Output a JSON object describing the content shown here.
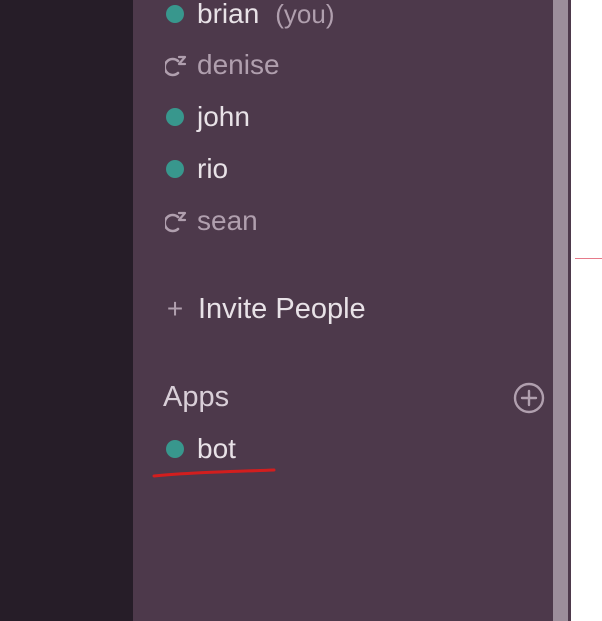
{
  "members": [
    {
      "name": "brian",
      "suffix": "(you)",
      "status": "active"
    },
    {
      "name": "denise",
      "status": "away"
    },
    {
      "name": "john",
      "status": "active"
    },
    {
      "name": "rio",
      "status": "active"
    },
    {
      "name": "sean",
      "status": "away"
    }
  ],
  "invite": {
    "plus_glyph": "+",
    "label": "Invite People"
  },
  "apps": {
    "header": "Apps",
    "items": [
      {
        "name": "bot",
        "status": "active"
      }
    ]
  },
  "colors": {
    "team_rail": "#261d28",
    "sidebar": "#4d394b",
    "active_presence": "#38978d",
    "text": "#e8e2e7",
    "away_text": "#b09fae",
    "annotation": "#d21e1e"
  },
  "icons": {
    "active": "presence-dot-icon",
    "away": "away-status-icon",
    "add_app": "plus-circle-icon"
  }
}
